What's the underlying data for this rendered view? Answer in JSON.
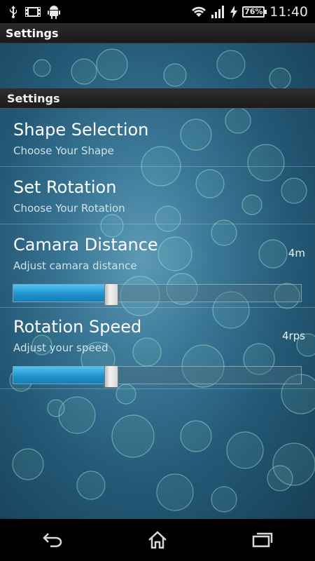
{
  "status_bar": {
    "icons_left": [
      "usb-icon",
      "film-icon",
      "android-icon"
    ],
    "icons_right": [
      "wifi-icon",
      "signal-icon",
      "charging-icon"
    ],
    "battery": "76%",
    "time": "11:40"
  },
  "action_bar": {
    "title": "Settings"
  },
  "section": {
    "title": "Settings"
  },
  "prefs": {
    "shape": {
      "title": "Shape Selection",
      "summary": "Choose Your Shape"
    },
    "rotation": {
      "title": "Set Rotation",
      "summary": "Choose Your Rotation"
    },
    "distance": {
      "title": "Camara Distance",
      "summary": "Adjust camara distance",
      "value": "4m",
      "level": 0.34
    },
    "speed": {
      "title": "Rotation Speed",
      "summary": "Adjust your speed",
      "value": "4rps",
      "level": 0.34
    }
  },
  "nav": {
    "back": "back-icon",
    "home": "home-icon",
    "recents": "recents-icon"
  },
  "colors": {
    "accent": "#1d8fc9",
    "wallpaper": "#3a7796"
  }
}
